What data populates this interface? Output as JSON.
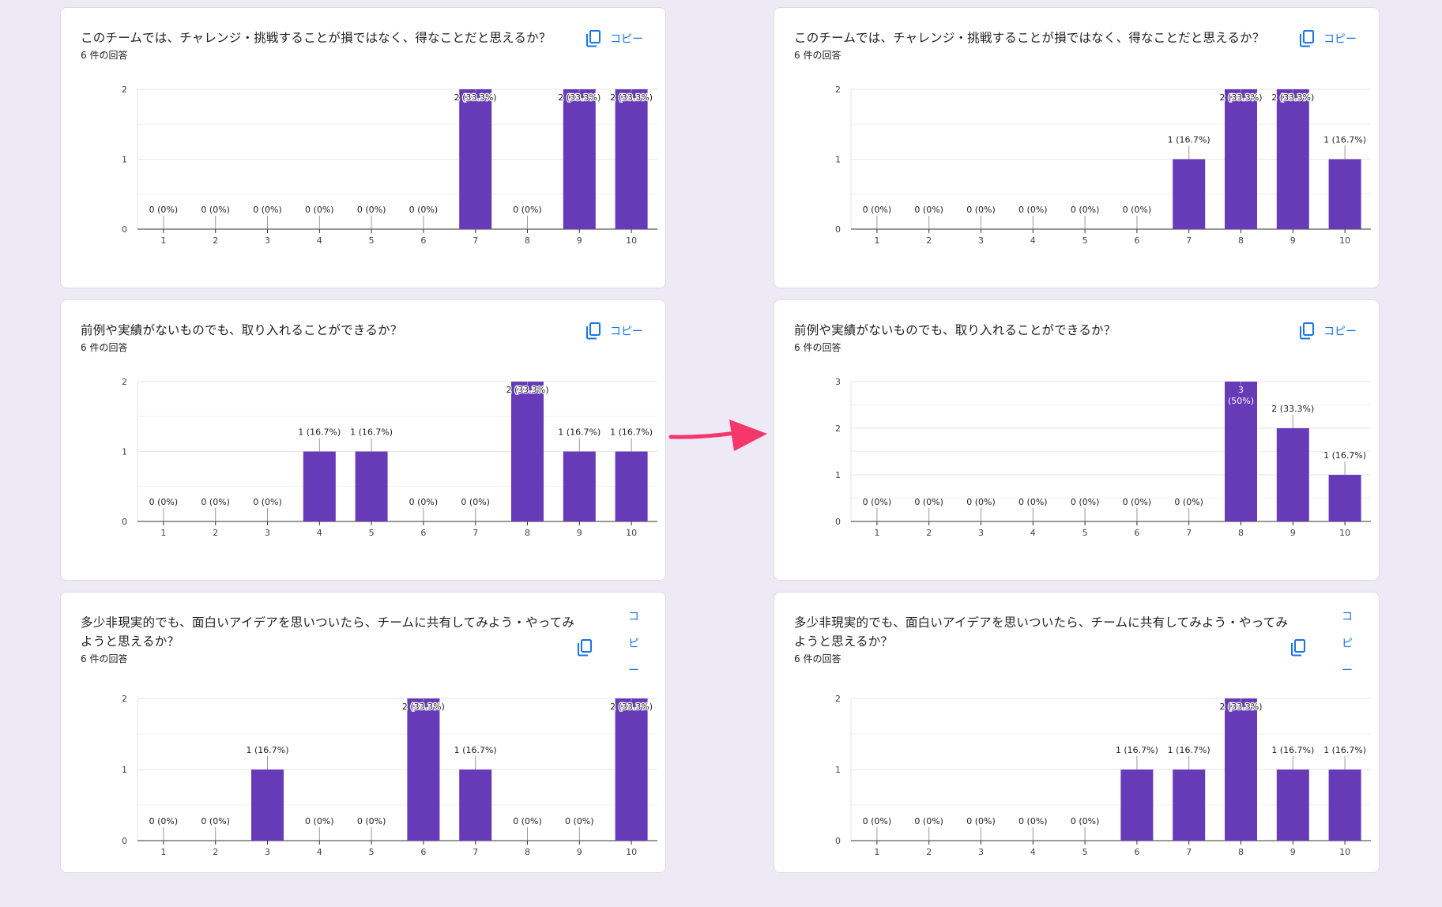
{
  "cards": [
    {
      "title": "このチームでは、チャレンジ・挑戦することが損ではなく、得なことだと思えるか？",
      "responses": "6 件の回答",
      "copy_label": "コピー",
      "chart_data": {
        "type": "bar",
        "categories": [
          "1",
          "2",
          "3",
          "4",
          "5",
          "6",
          "7",
          "8",
          "9",
          "10"
        ],
        "values": [
          0,
          0,
          0,
          0,
          0,
          0,
          2,
          0,
          2,
          2
        ],
        "labels": [
          "0 (0%)",
          "0 (0%)",
          "0 (0%)",
          "0 (0%)",
          "0 (0%)",
          "0 (0%)",
          "2 (33.3%)",
          "0 (0%)",
          "2 (33.3%)",
          "2 (33.3%)"
        ],
        "ylim": [
          0,
          2
        ],
        "yticks": [
          "0",
          "1",
          "2"
        ],
        "bar_color": "#673ab7",
        "grid": true
      }
    },
    {
      "title": "このチームでは、チャレンジ・挑戦することが損ではなく、得なことだと思えるか？",
      "responses": "6 件の回答",
      "copy_label": "コピー",
      "chart_data": {
        "type": "bar",
        "categories": [
          "1",
          "2",
          "3",
          "4",
          "5",
          "6",
          "7",
          "8",
          "9",
          "10"
        ],
        "values": [
          0,
          0,
          0,
          0,
          0,
          0,
          1,
          2,
          2,
          1
        ],
        "labels": [
          "0 (0%)",
          "0 (0%)",
          "0 (0%)",
          "0 (0%)",
          "0 (0%)",
          "0 (0%)",
          "1 (16.7%)",
          "2 (33.3%)",
          "2 (33.3%)",
          "1 (16.7%)"
        ],
        "ylim": [
          0,
          2
        ],
        "yticks": [
          "0",
          "1",
          "2"
        ],
        "bar_color": "#673ab7",
        "grid": true
      }
    },
    {
      "title": "前例や実績がないものでも、取り入れることができるか？",
      "responses": "6 件の回答",
      "copy_label": "コピー",
      "chart_data": {
        "type": "bar",
        "categories": [
          "1",
          "2",
          "3",
          "4",
          "5",
          "6",
          "7",
          "8",
          "9",
          "10"
        ],
        "values": [
          0,
          0,
          0,
          1,
          1,
          0,
          0,
          2,
          1,
          1
        ],
        "labels": [
          "0 (0%)",
          "0 (0%)",
          "0 (0%)",
          "1 (16.7%)",
          "1 (16.7%)",
          "0 (0%)",
          "0 (0%)",
          "2 (33.3%)",
          "1 (16.7%)",
          "1 (16.7%)"
        ],
        "ylim": [
          0,
          2
        ],
        "yticks": [
          "0",
          "1",
          "2"
        ],
        "bar_color": "#673ab7",
        "grid": true
      }
    },
    {
      "title": "前例や実績がないものでも、取り入れることができるか？",
      "responses": "6 件の回答",
      "copy_label": "コピー",
      "chart_data": {
        "type": "bar",
        "categories": [
          "1",
          "2",
          "3",
          "4",
          "5",
          "6",
          "7",
          "8",
          "9",
          "10"
        ],
        "values": [
          0,
          0,
          0,
          0,
          0,
          0,
          0,
          3,
          2,
          1
        ],
        "labels": [
          "0 (0%)",
          "0 (0%)",
          "0 (0%)",
          "0 (0%)",
          "0 (0%)",
          "0 (0%)",
          "0 (0%)",
          "3\n(50%)",
          "2 (33.3%)",
          "1 (16.7%)"
        ],
        "ylim": [
          0,
          3
        ],
        "yticks": [
          "0",
          "1",
          "2",
          "3"
        ],
        "bar_color": "#673ab7",
        "grid": true
      }
    },
    {
      "title": "多少非現実的でも、面白いアイデアを思いついたら、チームに共有してみよう・やってみようと思えるか？",
      "responses": "6 件の回答",
      "copy_label": "コピー",
      "chart_data": {
        "type": "bar",
        "categories": [
          "1",
          "2",
          "3",
          "4",
          "5",
          "6",
          "7",
          "8",
          "9",
          "10"
        ],
        "values": [
          0,
          0,
          1,
          0,
          0,
          2,
          1,
          0,
          0,
          2
        ],
        "labels": [
          "0 (0%)",
          "0 (0%)",
          "1 (16.7%)",
          "0 (0%)",
          "0 (0%)",
          "2 (33.3%)",
          "1 (16.7%)",
          "0 (0%)",
          "0 (0%)",
          "2 (33.3%)"
        ],
        "ylim": [
          0,
          2
        ],
        "yticks": [
          "0",
          "1",
          "2"
        ],
        "bar_color": "#673ab7",
        "grid": true
      }
    },
    {
      "title": "多少非現実的でも、面白いアイデアを思いついたら、チームに共有してみよう・やってみようと思えるか？",
      "responses": "6 件の回答",
      "copy_label": "コピー",
      "chart_data": {
        "type": "bar",
        "categories": [
          "1",
          "2",
          "3",
          "4",
          "5",
          "6",
          "7",
          "8",
          "9",
          "10"
        ],
        "values": [
          0,
          0,
          0,
          0,
          0,
          1,
          1,
          2,
          1,
          1
        ],
        "labels": [
          "0 (0%)",
          "0 (0%)",
          "0 (0%)",
          "0 (0%)",
          "0 (0%)",
          "1 (16.7%)",
          "1 (16.7%)",
          "2 (33.3%)",
          "1 (16.7%)",
          "1 (16.7%)"
        ],
        "ylim": [
          0,
          2
        ],
        "yticks": [
          "0",
          "1",
          "2"
        ],
        "bar_color": "#673ab7",
        "grid": true
      }
    }
  ],
  "arrow_color": "#f5366b"
}
